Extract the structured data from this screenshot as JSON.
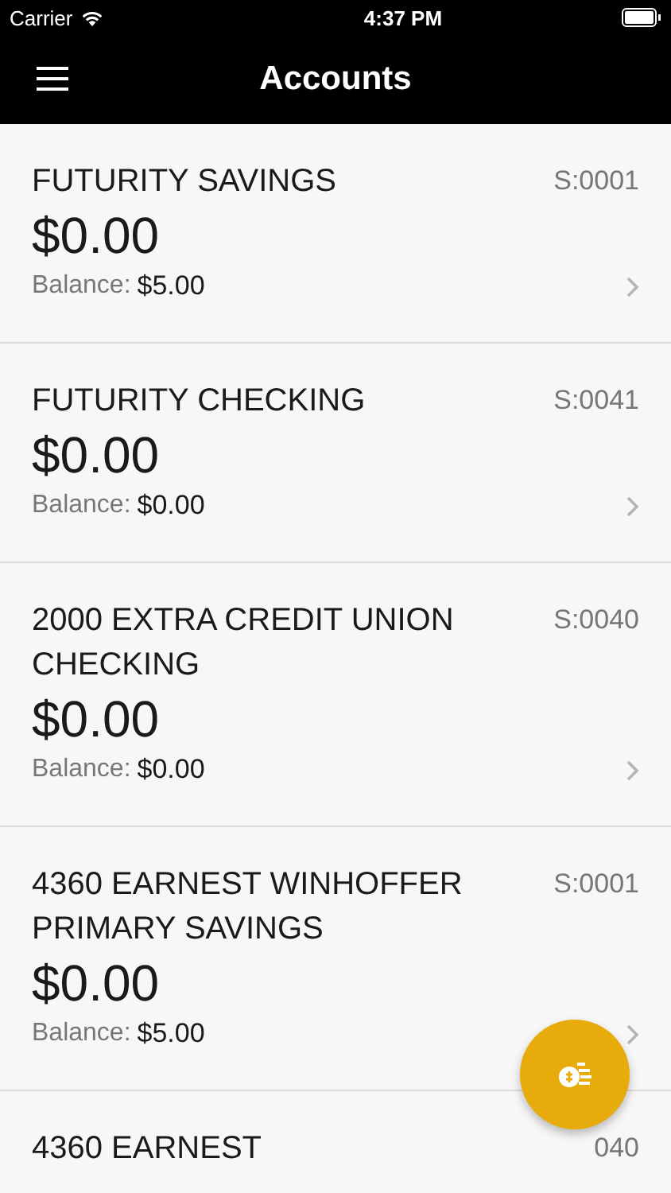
{
  "status_bar": {
    "carrier": "Carrier",
    "time": "4:37 PM"
  },
  "nav_bar": {
    "title": "Accounts"
  },
  "accounts": [
    {
      "name": "FUTURITY SAVINGS",
      "code": "S:0001",
      "amount": "$0.00",
      "balance_label": "Balance:",
      "balance": "$5.00"
    },
    {
      "name": "FUTURITY CHECKING",
      "code": "S:0041",
      "amount": "$0.00",
      "balance_label": "Balance:",
      "balance": "$0.00"
    },
    {
      "name": "2000 EXTRA CREDIT UNION CHECKING",
      "code": "S:0040",
      "amount": "$0.00",
      "balance_label": "Balance:",
      "balance": "$0.00"
    },
    {
      "name": "4360 EARNEST WINHOFFER PRIMARY SAVINGS",
      "code": "S:0001",
      "amount": "$0.00",
      "balance_label": "Balance:",
      "balance": "$5.00"
    },
    {
      "name": "4360 EARNEST",
      "code": "040"
    }
  ]
}
